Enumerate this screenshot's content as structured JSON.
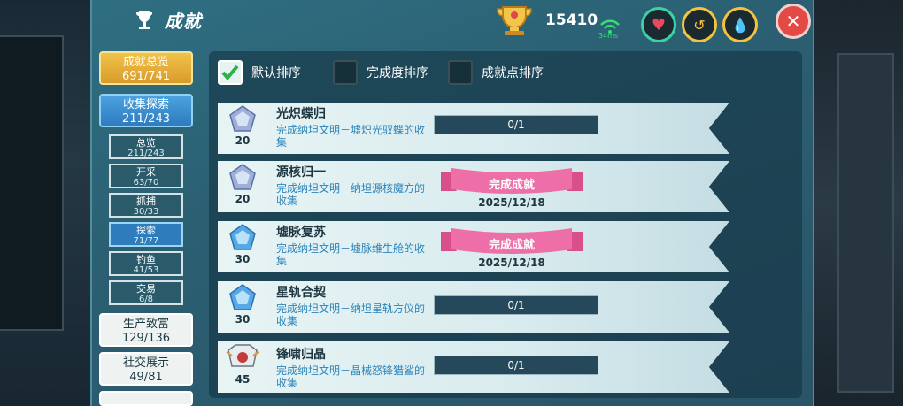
{
  "header": {
    "title": "成就",
    "achievement_points": "15410",
    "ping": "34ms"
  },
  "sort": {
    "options": [
      {
        "label": "默认排序",
        "checked": true
      },
      {
        "label": "完成度排序",
        "checked": false
      },
      {
        "label": "成就点排序",
        "checked": false
      }
    ]
  },
  "nav": {
    "overview": {
      "label": "成就总览",
      "count": "691/741"
    },
    "explore": {
      "label": "收集探索",
      "count": "211/243"
    },
    "subs": [
      {
        "label": "总览",
        "count": "211/243"
      },
      {
        "label": "开采",
        "count": "63/70"
      },
      {
        "label": "抓捕",
        "count": "30/33"
      },
      {
        "label": "探索",
        "count": "71/77"
      },
      {
        "label": "钓鱼",
        "count": "41/53"
      },
      {
        "label": "交易",
        "count": "6/8"
      }
    ],
    "production": {
      "label": "生产致富",
      "count": "129/136"
    },
    "social": {
      "label": "社交展示",
      "count": "49/81"
    }
  },
  "achievements": [
    {
      "title": "光炽蝶归",
      "desc": "完成纳坦文明－墟炽光驭蝶的收集",
      "points": "20",
      "progress": "0/1",
      "completed": false
    },
    {
      "title": "源核归一",
      "desc": "完成纳坦文明－纳坦源核魔方的收集",
      "points": "20",
      "completed": true,
      "status": "完成成就",
      "date": "2025/12/18"
    },
    {
      "title": "墟脉复苏",
      "desc": "完成纳坦文明－墟脉维生舱的收集",
      "points": "30",
      "completed": true,
      "status": "完成成就",
      "date": "2025/12/18"
    },
    {
      "title": "星轨合契",
      "desc": "完成纳坦文明－纳坦星轨方仪的收集",
      "points": "30",
      "progress": "0/1",
      "completed": false
    },
    {
      "title": "锋啸归晶",
      "desc": "完成纳坦文明－晶械怒锋猎鲨的收集",
      "points": "45",
      "progress": "0/1",
      "completed": false
    }
  ],
  "colors": {
    "accent_gold": "#f1c34a",
    "accent_blue": "#2f7cbc",
    "ribbon": "#ee6fa8",
    "close": "#e14a45"
  }
}
